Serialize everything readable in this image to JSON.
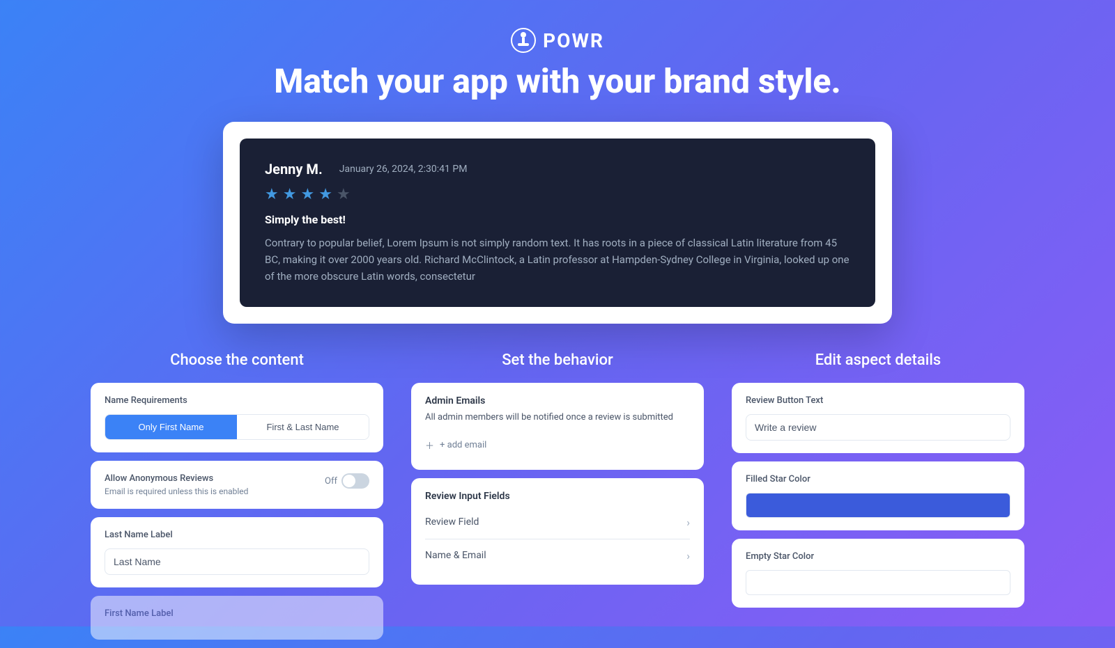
{
  "logo": {
    "text": "POWR"
  },
  "headline": "Match your app with your brand style.",
  "review": {
    "reviewer": "Jenny M.",
    "date": "January 26, 2024, 2:30:41 PM",
    "stars": 4,
    "max_stars": 5,
    "title": "Simply the best!",
    "body": "Contrary to popular belief, Lorem Ipsum is not simply random text. It has roots in a piece of classical Latin literature from 45 BC, making it over 2000 years old. Richard McClintock, a Latin professor at Hampden-Sydney College in Virginia, looked up one of the more obscure Latin words, consectetur"
  },
  "columns": {
    "content": {
      "title": "Choose the content",
      "name_requirements": {
        "label": "Name Requirements",
        "options": [
          {
            "label": "Only First Name",
            "active": true
          },
          {
            "label": "First & Last Name",
            "active": false
          }
        ]
      },
      "anonymous_reviews": {
        "label": "Allow Anonymous Reviews",
        "sublabel": "Email is required unless this is enabled",
        "toggle_state": "Off"
      },
      "last_name_label": {
        "label": "Last Name Label",
        "value": "Last Name",
        "placeholder": "Last Name"
      },
      "first_name_label": {
        "label": "First Name Label"
      }
    },
    "behavior": {
      "title": "Set the behavior",
      "admin_emails": {
        "label": "Admin Emails",
        "description": "All admin members will be notified once a review is submitted",
        "add_email_placeholder": "+ add email"
      },
      "review_input_fields": {
        "label": "Review Input Fields",
        "fields": [
          {
            "name": "Review Field"
          },
          {
            "name": "Name & Email"
          }
        ]
      }
    },
    "aspect": {
      "title": "Edit aspect details",
      "review_button_text": {
        "label": "Review Button Text",
        "value": "Write a review"
      },
      "filled_star_color": {
        "label": "Filled Star Color",
        "color": "#3b5bdb"
      },
      "empty_star_color": {
        "label": "Empty Star Color",
        "color": "#ffffff"
      }
    }
  }
}
